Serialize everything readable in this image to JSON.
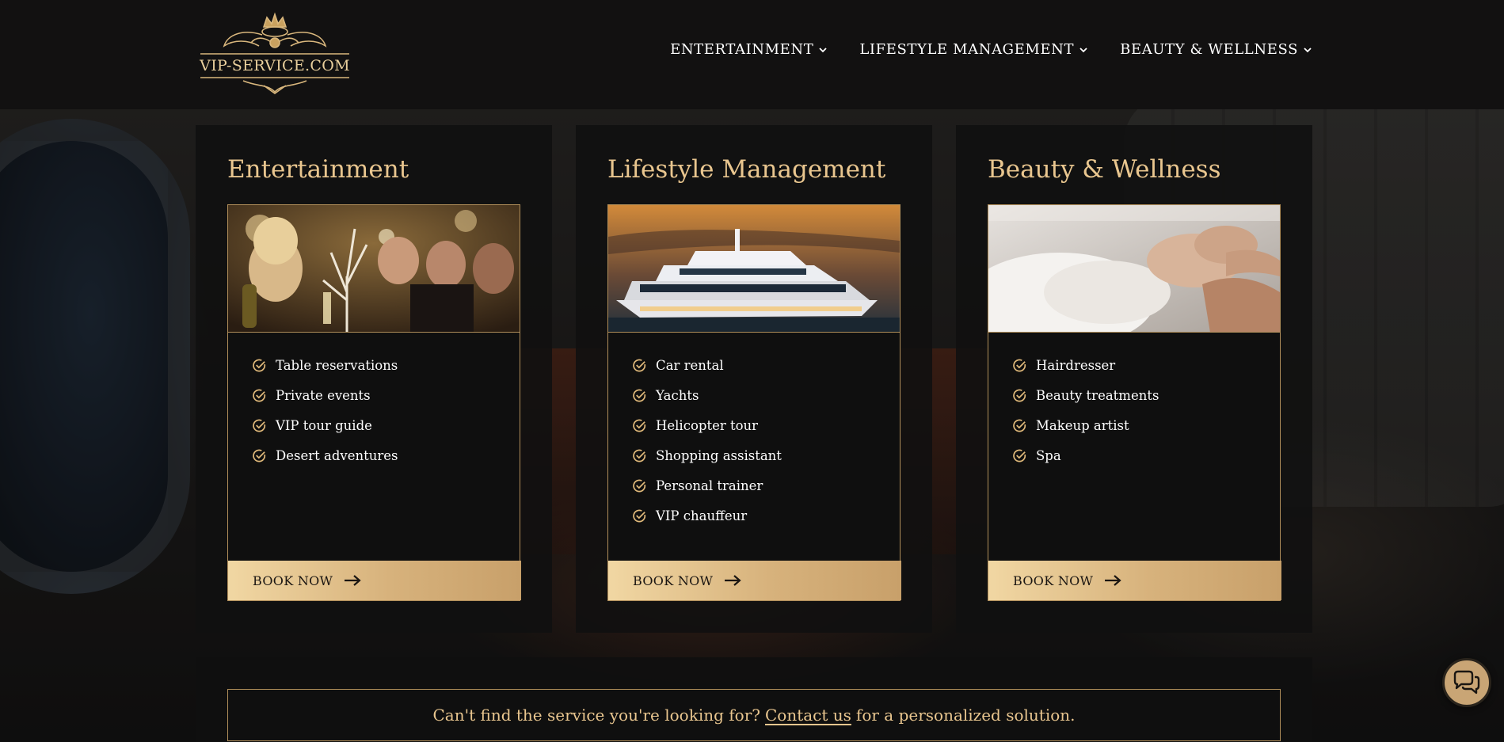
{
  "header": {
    "logo_text": "VIP-SERVICE.COM",
    "nav": [
      {
        "label": "ENTERTAINMENT"
      },
      {
        "label": "LIFESTYLE MANAGEMENT"
      },
      {
        "label": "BEAUTY & WELLNESS"
      }
    ]
  },
  "cards": [
    {
      "title": "Entertainment",
      "image_desc": "friends-toasting-champagne",
      "items": [
        "Table reservations",
        "Private events",
        "VIP tour guide",
        "Desert adventures"
      ],
      "cta": "BOOK NOW"
    },
    {
      "title": "Lifestyle Management",
      "image_desc": "luxury-yacht-at-sunset",
      "items": [
        "Car rental",
        "Yachts",
        "Helicopter tour",
        "Shopping assistant",
        "Personal trainer",
        "VIP chauffeur"
      ],
      "cta": "BOOK NOW"
    },
    {
      "title": "Beauty & Wellness",
      "image_desc": "spa-head-massage",
      "items": [
        "Hairdresser",
        "Beauty treatments",
        "Makeup artist",
        "Spa"
      ],
      "cta": "BOOK NOW"
    }
  ],
  "contact": {
    "before": "Can't find the service you're looking for?",
    "link": "Contact us",
    "after": "for a personalized solution."
  },
  "colors": {
    "gold": "#e9c68f",
    "gold_border": "#b08e5a",
    "header_bg": "#121111",
    "card_bg": "#101010"
  },
  "icons": {
    "chat": "chat-bubbles-icon",
    "check": "check-circle-icon",
    "arrow": "arrow-right-icon",
    "chevron": "chevron-down-icon"
  }
}
